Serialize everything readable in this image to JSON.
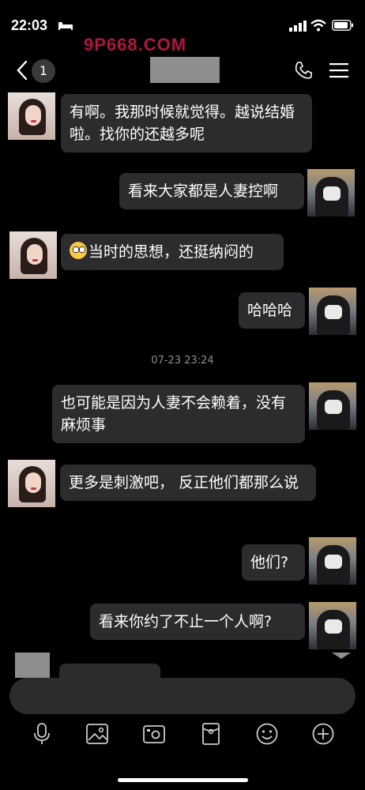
{
  "status_bar": {
    "time": "22:03"
  },
  "watermark": "9P668.COM",
  "nav": {
    "unread_count": "1"
  },
  "messages": [
    {
      "side": "left",
      "text": "有啊。我那时候就觉得。越说结婚啦。找你的还越多呢"
    },
    {
      "side": "right",
      "text": "看来大家都是人妻控啊"
    },
    {
      "side": "left",
      "text": "当时的思想，还挺纳闷的",
      "emoji": "flushed-face"
    },
    {
      "side": "right",
      "text": "哈哈哈"
    },
    {
      "side": "right",
      "text": "也可能是因为人妻不会赖着，没有麻烦事"
    },
    {
      "side": "left",
      "text": "更多是刺激吧， 反正他们都那么说"
    },
    {
      "side": "right",
      "text": "他们?"
    },
    {
      "side": "right",
      "text": "看来你约了不止一个人啊?"
    }
  ],
  "timestamp": "07-23 23:24",
  "toolbar": [
    "microphone-icon",
    "image-icon",
    "camera-icon",
    "red-packet-icon",
    "emoji-icon",
    "plus-icon"
  ]
}
